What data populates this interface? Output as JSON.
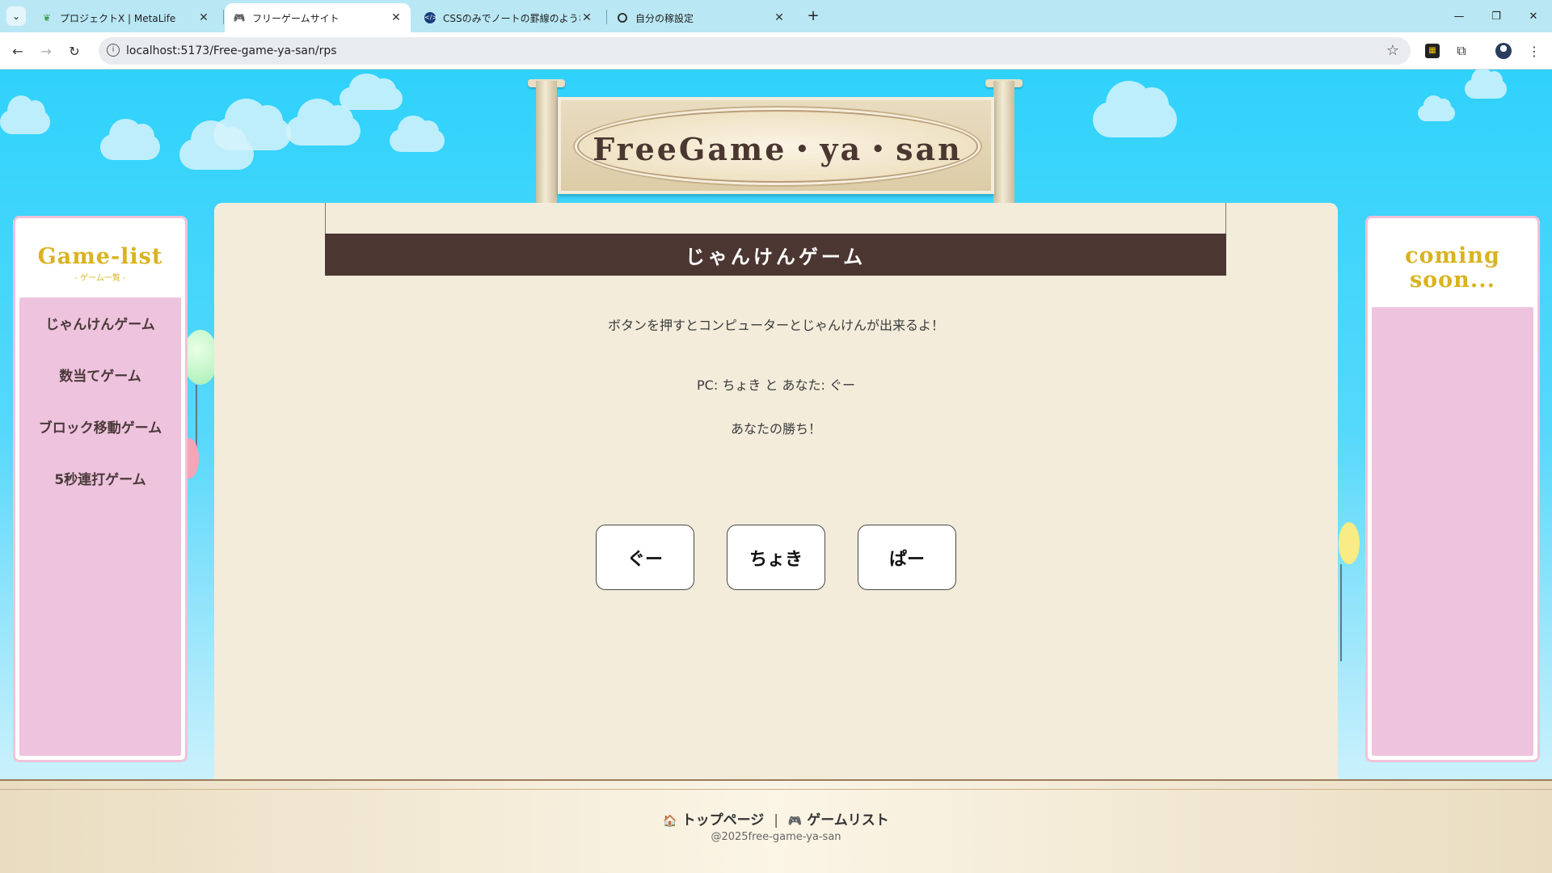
{
  "browser": {
    "tabs": [
      {
        "title": "プロジェクトX | MetaLife",
        "icon": "metalife-icon"
      },
      {
        "title": "フリーゲームサイト",
        "icon": "gamepad-icon"
      },
      {
        "title": "CSSのみでノートの罫線のようなスタ",
        "icon": "code-icon"
      },
      {
        "title": "自分の稼設定",
        "icon": "target-icon"
      }
    ],
    "url": "localhost:5173/Free-game-ya-san/rps"
  },
  "sign": {
    "title": "FreeGame・ya・san"
  },
  "sidebar_left": {
    "title": "Game-list",
    "subtitle": "- ゲーム一覧 -",
    "items": [
      {
        "label": "じゃんけんゲーム"
      },
      {
        "label": "数当てゲーム"
      },
      {
        "label": "ブロック移動ゲーム"
      },
      {
        "label": "5秒連打ゲーム"
      }
    ]
  },
  "sidebar_right": {
    "title_line1": "coming",
    "title_line2": "soon..."
  },
  "game": {
    "title": "じゃんけんゲーム",
    "description": "ボタンを押すとコンピューターとじゃんけんが出来るよ！",
    "result_hands": "PC: ちょき と あなた: ぐー",
    "result_message": "あなたの勝ち！",
    "buttons": [
      {
        "label": "ぐー"
      },
      {
        "label": "ちょき"
      },
      {
        "label": "ぱー"
      }
    ]
  },
  "footer": {
    "top_icon": "house-icon",
    "top_label": "トップページ",
    "separator": "|",
    "list_icon": "gamepad-icon",
    "list_label": "ゲームリスト",
    "copyright": "@2025free-game-ya-san"
  }
}
